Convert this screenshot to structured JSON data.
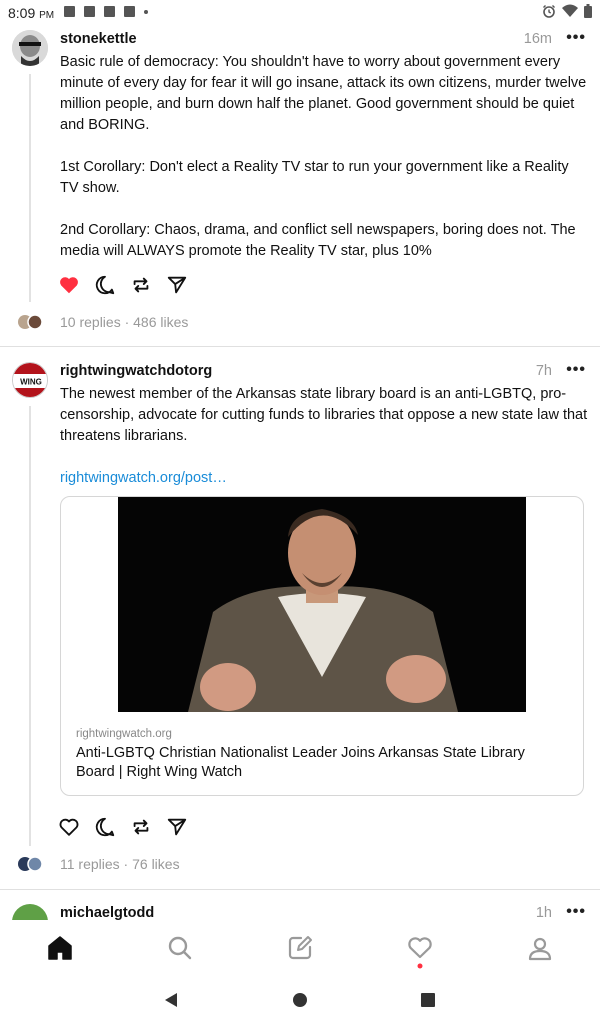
{
  "status_bar": {
    "time": "8:09",
    "ampm": "PM"
  },
  "posts": [
    {
      "username": "stonekettle",
      "time": "16m",
      "more": "•••",
      "text": "Basic rule of democracy: You shouldn't have to worry about government every minute of every day for fear it will go insane, attack its own citizens, murder twelve million people, and burn down half the planet. Good government should be quiet and BORING.\n\n1st Corollary: Don't elect a Reality TV star to run your government like a Reality TV show.\n\n2nd Corollary: Chaos, drama, and conflict sell newspapers, boring does not. The media will ALWAYS promote the Reality TV star, plus 10%",
      "stats": "10 replies · 486 likes",
      "liked": true
    },
    {
      "username": "rightwingwatchdotorg",
      "time": "7h",
      "more": "•••",
      "text": "The newest member of the Arkansas state library board is an anti-LGBTQ, pro-censorship, advocate for cutting funds to libraries that oppose a new state law that threatens librarians.",
      "link": "rightwingwatch.org/post…",
      "avatar_text": "WING",
      "card": {
        "domain": "rightwingwatch.org",
        "title": "Anti-LGBTQ Christian Nationalist Leader Joins Arkansas State Library Board | Right Wing Watch"
      },
      "stats": "11 replies · 76 likes",
      "liked": false
    },
    {
      "username": "michaelgtodd",
      "time": "1h",
      "more": "•••"
    }
  ],
  "colors": {
    "like_red": "#ff3040",
    "link_blue": "#1a8cd8",
    "muted": "#999999",
    "notification_dot": "#ff3040"
  },
  "nav": [
    "home-icon",
    "search-icon",
    "compose-icon",
    "activity-heart-icon",
    "profile-icon"
  ]
}
